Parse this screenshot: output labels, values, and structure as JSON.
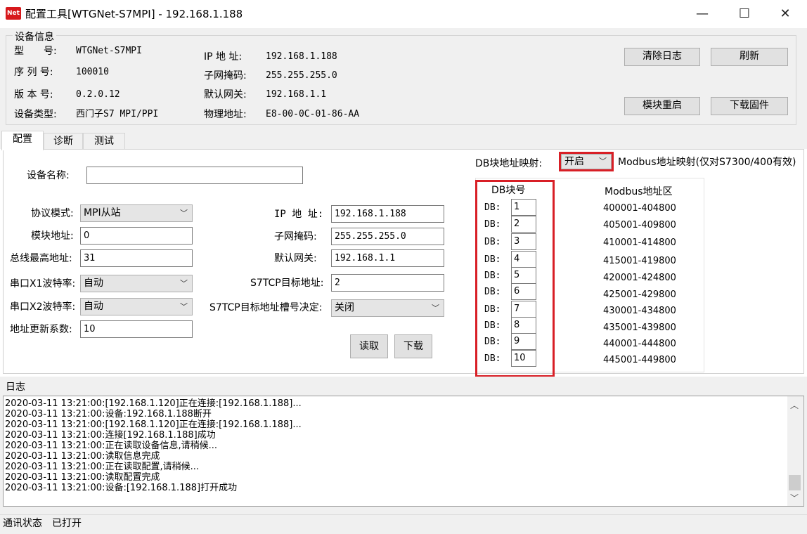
{
  "window": {
    "icon_text": "Net",
    "title": "配置工具[WTGNet-S7MPI] - 192.168.1.188",
    "minimize": "—",
    "maximize": "☐",
    "close": "✕"
  },
  "device_info": {
    "group_title": "设备信息",
    "model_label": "型　　号:",
    "model_value": "WTGNet-S7MPI",
    "serial_label": "序 列 号:",
    "serial_value": "100010",
    "version_label": "版 本 号:",
    "version_value": "0.2.0.12",
    "type_label": "设备类型:",
    "type_value": "西门子S7 MPI/PPI",
    "ip_label": "IP 地 址:",
    "ip_value": "192.168.1.188",
    "mask_label": "子网掩码:",
    "mask_value": "255.255.255.0",
    "gateway_label": "默认网关:",
    "gateway_value": "192.168.1.1",
    "mac_label": "物理地址:",
    "mac_value": "E8-00-0C-01-86-AA",
    "buttons": {
      "clear_log": "清除日志",
      "refresh": "刷新",
      "restart": "模块重启",
      "download_fw": "下载固件"
    }
  },
  "tabs": [
    "配置",
    "诊断",
    "测试"
  ],
  "config": {
    "device_name_label": "设备名称:",
    "device_name_value": "",
    "protocol_label": "协议模式:",
    "protocol_value": "MPI从站",
    "module_addr_label": "模块地址:",
    "module_addr_value": "0",
    "bus_max_label": "总线最高地址:",
    "bus_max_value": "31",
    "x1_baud_label": "串口X1波特率:",
    "x1_baud_value": "自动",
    "x2_baud_label": "串口X2波特率:",
    "x2_baud_value": "自动",
    "update_coef_label": "地址更新系数:",
    "update_coef_value": "10",
    "ip_label": "IP 地 址:",
    "ip_value": "192.168.1.188",
    "mask_label": "子网掩码:",
    "mask_value": "255.255.255.0",
    "gateway_label": "默认网关:",
    "gateway_value": "192.168.1.1",
    "s7tcp_target_label": "S7TCP目标地址:",
    "s7tcp_target_value": "2",
    "s7tcp_slot_label": "S7TCP目标地址槽号决定:",
    "s7tcp_slot_value": "关闭",
    "read_button": "读取",
    "download_button": "下载",
    "db_mapping_label": "DB块地址映射:",
    "db_mapping_value": "开启",
    "modbus_note": "Modbus地址映射(仅对S7300/400有效)",
    "db_header": "DB块号",
    "modbus_header": "Modbus地址区",
    "db_prefix": "DB:",
    "db_rows": [
      {
        "db": "1",
        "range": "400001-404800"
      },
      {
        "db": "2",
        "range": "405001-409800"
      },
      {
        "db": "3",
        "range": "410001-414800"
      },
      {
        "db": "4",
        "range": "415001-419800"
      },
      {
        "db": "5",
        "range": "420001-424800"
      },
      {
        "db": "6",
        "range": "425001-429800"
      },
      {
        "db": "7",
        "range": "430001-434800"
      },
      {
        "db": "8",
        "range": "435001-439800"
      },
      {
        "db": "9",
        "range": "440001-444800"
      },
      {
        "db": "10",
        "range": "445001-449800"
      }
    ]
  },
  "log": {
    "title": "日志",
    "lines": [
      "2020-03-11 13:21:00:[192.168.1.120]正在连接:[192.168.1.188]...",
      "2020-03-11 13:21:00:设备:192.168.1.188断开",
      "2020-03-11 13:21:00:[192.168.1.120]正在连接:[192.168.1.188]...",
      "2020-03-11 13:21:00:连接[192.168.1.188]成功",
      "2020-03-11 13:21:00:正在读取设备信息,请稍候...",
      "2020-03-11 13:21:00:读取信息完成",
      "2020-03-11 13:21:00:正在读取配置,请稍候...",
      "2020-03-11 13:21:00:读取配置完成",
      "2020-03-11 13:21:00:设备:[192.168.1.188]打开成功"
    ],
    "scroll_up": "︿",
    "scroll_down": "﹀"
  },
  "status": {
    "label": "通讯状态",
    "value": "已打开"
  },
  "colors": {
    "highlight": "#d81f26",
    "panel": "#f0f0f0",
    "icon_bg": "#d7191c"
  }
}
